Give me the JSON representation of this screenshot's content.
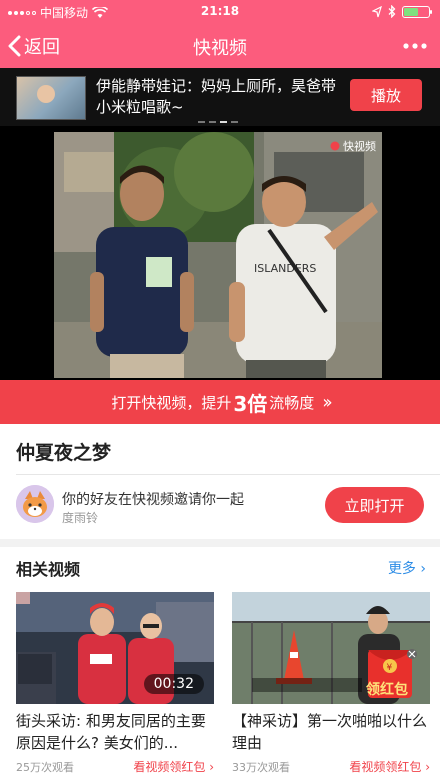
{
  "status_bar": {
    "carrier": "中国移动",
    "time": "21:18"
  },
  "nav": {
    "back_label": "返回",
    "title": "快视频"
  },
  "banner": {
    "title": "伊能静带娃记：妈妈上厕所，昊爸带小米粒唱歌~",
    "play_label": "播放"
  },
  "video": {
    "watermark": "快视频"
  },
  "promo": {
    "prefix": "打开快视频，提升",
    "highlight": "3倍",
    "suffix": "流畅度"
  },
  "video_title": "仲夏夜之梦",
  "invite": {
    "text": "你的好友在快视频邀请你一起",
    "name": "度雨铃",
    "open_label": "立即打开"
  },
  "related": {
    "title": "相关视频",
    "more_label": "更多",
    "items": [
      {
        "title": "街头采访: 和男友同居的主要原因是什么? 美女们的...",
        "views": "25万次观看",
        "link": "看视频领红包",
        "duration": "00:32"
      },
      {
        "title": "【神采访】第一次啪啪以什么理由",
        "views": "33万次观看",
        "link": "看视频领红包",
        "badge": "领红包"
      }
    ]
  },
  "colors": {
    "brand": "#fc5c7d",
    "accent": "#f0424a",
    "link": "#2e8de6"
  }
}
